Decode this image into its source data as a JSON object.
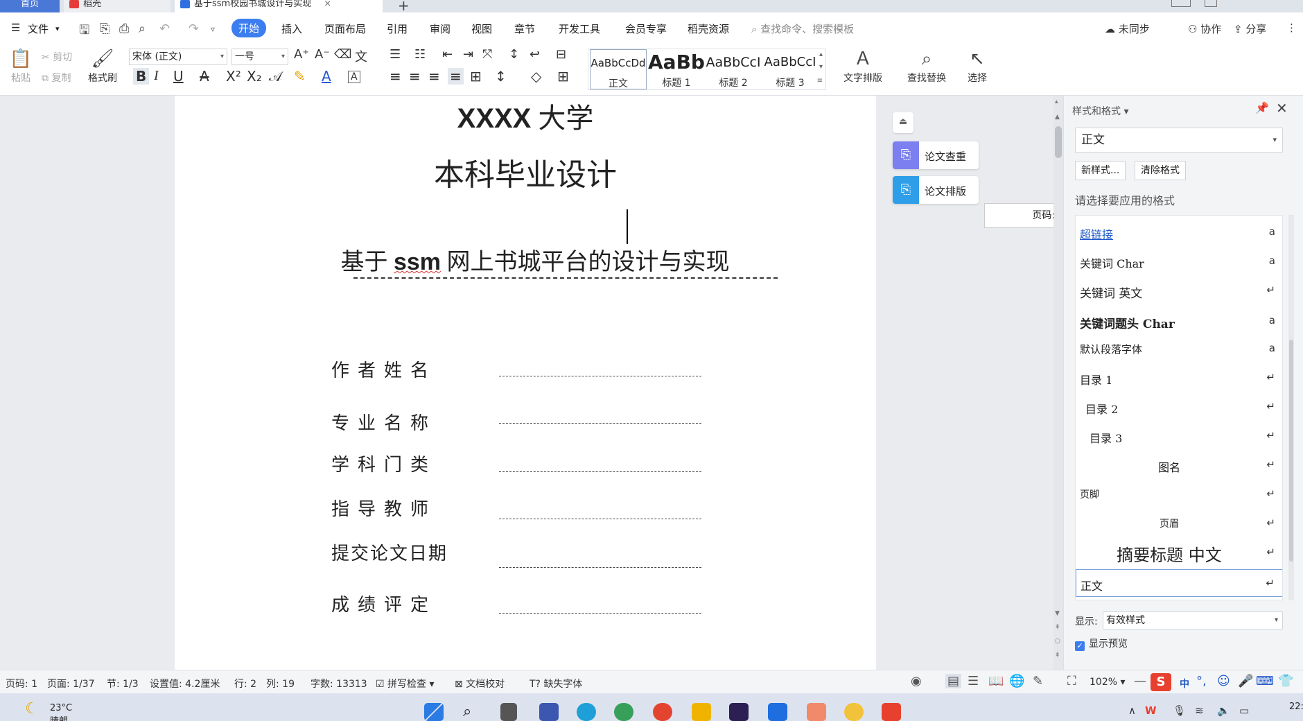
{
  "tabs": {
    "home": "首页",
    "daoke": "稻壳",
    "doc": "基于ssm校园书城设计与实现",
    "doc_close": "×",
    "plus": "+"
  },
  "menu": {
    "file": "文件",
    "items": [
      "开始",
      "插入",
      "页面布局",
      "引用",
      "审阅",
      "视图",
      "章节",
      "开发工具",
      "会员专享",
      "稻壳资源"
    ],
    "search": "查找命令、搜索模板",
    "unsync": "未同步",
    "collab": "协作",
    "share": "分享"
  },
  "ribbon": {
    "paste": "粘贴",
    "cut": "剪切",
    "copy": "复制",
    "format_painter": "格式刷",
    "font_name": "宋体 (正文)",
    "font_size": "一号",
    "styles": [
      {
        "preview": "AaBbCcDd",
        "name": "正文"
      },
      {
        "preview": "AaBb",
        "name": "标题 1"
      },
      {
        "preview": "AaBbCcI",
        "name": "标题 2"
      },
      {
        "preview": "AaBbCcI",
        "name": "标题 3"
      }
    ],
    "text_layout": "文字排版",
    "find_replace": "查找替换",
    "select": "选择"
  },
  "document": {
    "university_bold": "XXXX",
    "university_rest": " 大学",
    "subtitle": "本科毕业设计",
    "title_pre": "基于 ",
    "title_bold": "ssm",
    "title_post": " 网上书城平台的设计与实现",
    "fields": [
      "作者姓名",
      "专业名称",
      "学科门类",
      "指导教师",
      "提交论文日期",
      "成绩评定"
    ]
  },
  "side_buttons": {
    "check": "论文查重",
    "layout": "论文排版"
  },
  "tooltip": "页码: I",
  "style_pane": {
    "title": "样式和格式",
    "current": "正文",
    "new_style": "新样式...",
    "clear_format": "清除格式",
    "hint": "请选择要应用的格式",
    "items": [
      {
        "name": "超链接",
        "mark": "a"
      },
      {
        "name": "关键词 Char",
        "mark": "a"
      },
      {
        "name": "关键词 英文",
        "mark": "↵"
      },
      {
        "name": "关键词题头 Char",
        "mark": "a"
      },
      {
        "name": "默认段落字体",
        "mark": "a"
      },
      {
        "name": "目录 1",
        "mark": "↵"
      },
      {
        "name": "目录 2",
        "mark": "↵"
      },
      {
        "name": "目录 3",
        "mark": "↵"
      },
      {
        "name": "图名",
        "mark": "↵"
      },
      {
        "name": "页脚",
        "mark": "↵"
      },
      {
        "name": "页眉",
        "mark": "↵"
      },
      {
        "name": "摘要标题 中文",
        "mark": "↵"
      },
      {
        "name": "正文",
        "mark": "↵"
      }
    ],
    "show_label": "显示:",
    "show_value": "有效样式",
    "show_preview": "显示预览"
  },
  "status": {
    "page_code": "页码: 1",
    "page": "页面: 1/37",
    "section": "节: 1/3",
    "setting": "设置值: 4.2厘米",
    "row": "行: 2",
    "col": "列: 19",
    "words": "字数: 13313",
    "spell": "拼写检查",
    "proof": "文档校对",
    "missing_font": "缺失字体",
    "zoom": "102%"
  },
  "taskbar": {
    "temp": "23°C",
    "weather": "晴朗",
    "ime": "中",
    "clock": "22:"
  }
}
